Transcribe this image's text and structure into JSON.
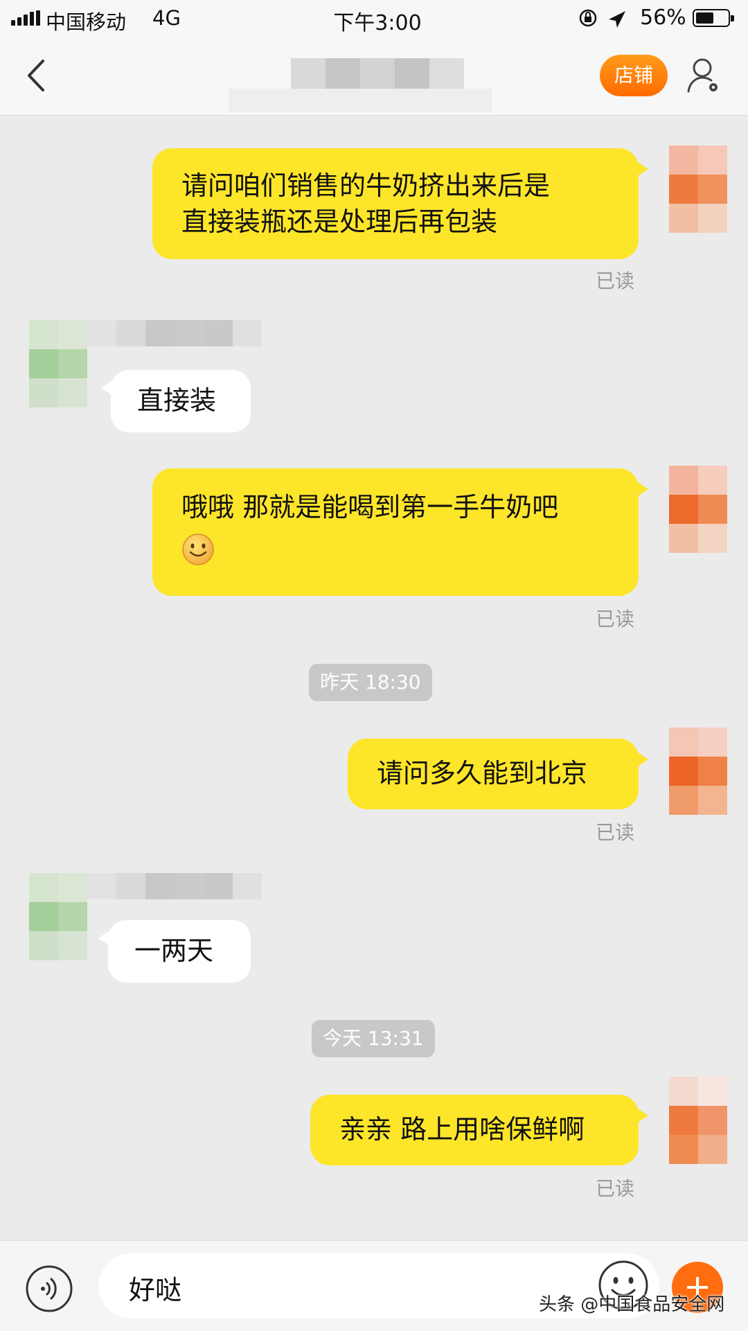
{
  "status_bar": {
    "carrier": "中国移动",
    "network": "4G",
    "time": "下午3:00",
    "battery": "56%",
    "battery_level": 0.56
  },
  "nav": {
    "back_icon": "chevron-left-icon",
    "shop_label": "店铺",
    "user_icon": "user-settings-icon"
  },
  "messages": [
    {
      "side": "me",
      "lines": [
        "请问咱们销售的牛奶挤出来后是",
        "直接装瓶还是处理后再包装"
      ],
      "status": "已读"
    },
    {
      "side": "them",
      "text": "直接装"
    },
    {
      "side": "me",
      "text": "哦哦 那就是能喝到第一手牛奶吧",
      "emoji": "smiley-emoji-icon",
      "status": "已读"
    },
    {
      "timestamp": "昨天 18:30"
    },
    {
      "side": "me",
      "text": "请问多久能到北京",
      "status": "已读"
    },
    {
      "side": "them",
      "text": "一两天"
    },
    {
      "timestamp": "今天 13:31"
    },
    {
      "side": "me",
      "text": "亲亲 路上用啥保鲜啊",
      "status": "已读"
    }
  ],
  "input": {
    "value": "好哒",
    "voice_icon": "voice-icon",
    "emoji_icon": "emoji-icon",
    "plus_icon": "plus-icon"
  },
  "watermark": "头条 @中国食品安全网",
  "colors": {
    "my_bubble": "#fde52a",
    "their_bubble": "#ffffff",
    "accent": "#ff6d10",
    "background": "#ebebeb"
  }
}
